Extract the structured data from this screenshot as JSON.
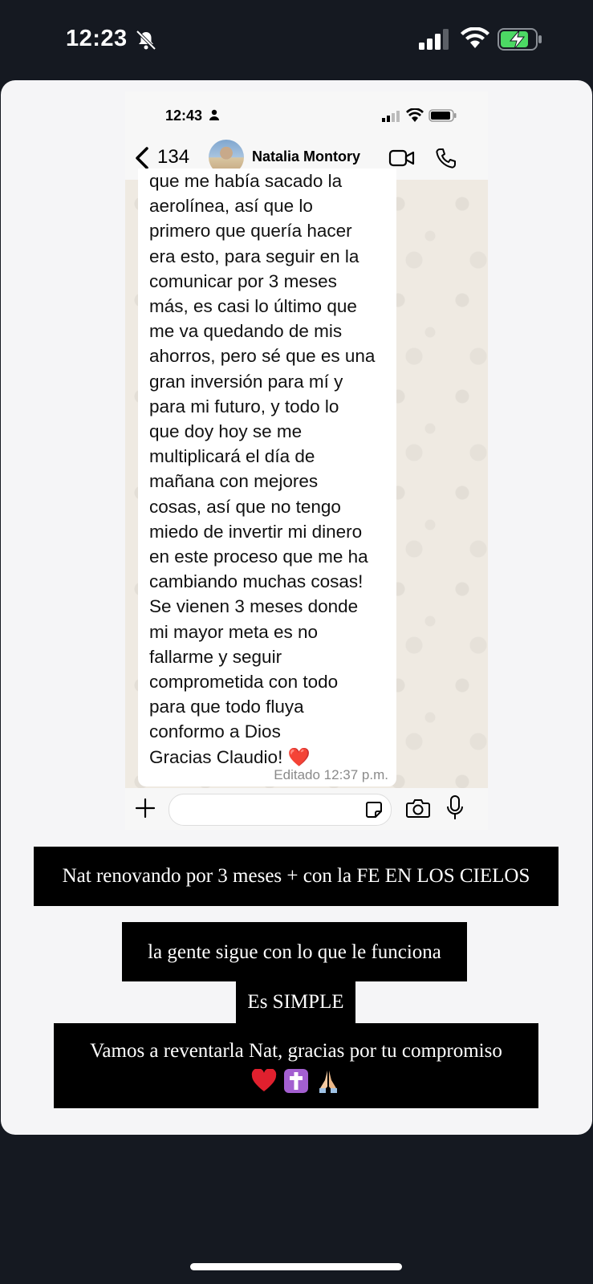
{
  "os_status": {
    "time": "12:23"
  },
  "inner_status": {
    "time": "12:43"
  },
  "chat_header": {
    "back_count": "134",
    "contact_name": "Natalia Montory"
  },
  "message": {
    "text": "que me había sacado la\naerolínea, así que lo\nprimero que quería hacer\nera esto, para seguir en la\ncomunicar por 3 meses\nmás, es casi lo último que\nme va quedando de mis\nahorros, pero sé que es una\ngran inversión para mí y\npara mi futuro, y todo lo\nque doy hoy se me\nmultiplicará el día de\nmañana con mejores\ncosas, así que no tengo\nmiedo de invertir mi dinero\nen este proceso que me ha\ncambiando muchas cosas!\nSe vienen 3 meses donde\nmi mayor meta es no\nfallarme y seguir\ncomprometida con todo\npara que todo fluya\nconformo a Dios\nGracias Claudio! ❤️",
    "meta": "Editado  12:37 p.m."
  },
  "captions": {
    "line1": "Nat renovando por 3 meses + con la FE EN LOS CIELOS",
    "line2": "la gente sigue con lo que le funciona",
    "line3": "Es SIMPLE",
    "line4": "Vamos a reventarla Nat, gracias por tu compromiso"
  },
  "icons": [
    "bell-slash-icon",
    "signal-icon",
    "wifi-icon",
    "battery-charging-icon",
    "person-icon",
    "back-chevron-icon",
    "video-call-icon",
    "phone-icon",
    "plus-icon",
    "sticker-icon",
    "camera-icon",
    "microphone-icon",
    "heart-emoji-icon",
    "cross-emoji-icon",
    "praying-hands-emoji-icon"
  ],
  "colors": {
    "background": "#151921",
    "card": "#f5f5f7",
    "chat_bg": "#efeae2",
    "battery_green": "#4cd964",
    "caption_bg": "#000000"
  }
}
